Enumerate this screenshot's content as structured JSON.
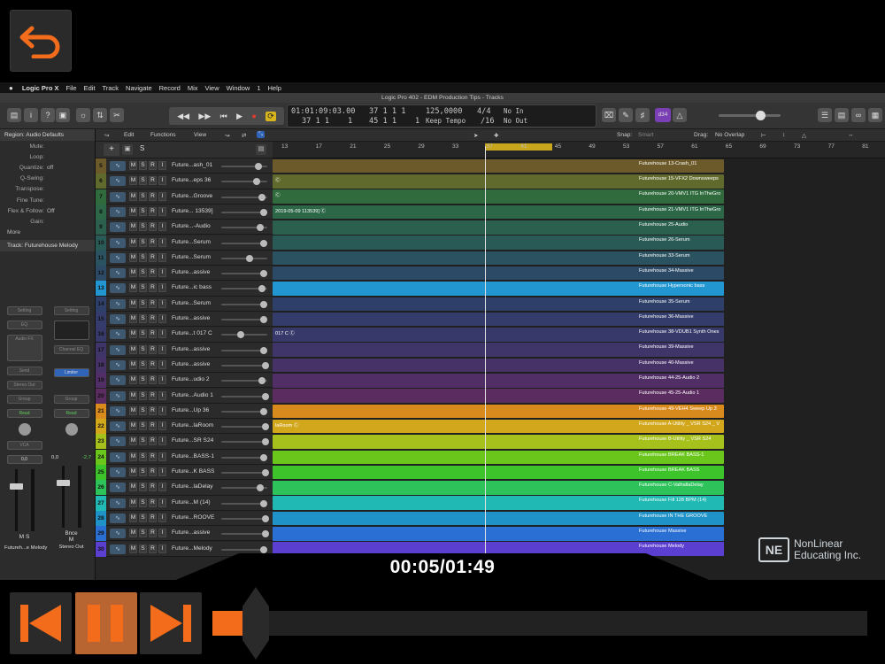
{
  "player": {
    "timecode": "00:05/01:49",
    "progress": 0.046,
    "accent_color": "#f26c1b",
    "back_icon": "back-arrow-icon",
    "watermark": {
      "logo": "NE",
      "line1": "NonLinear",
      "line2": "Educating Inc."
    }
  },
  "mac_menu": {
    "app": "Logic Pro X",
    "items": [
      "File",
      "Edit",
      "Track",
      "Navigate",
      "Record",
      "Mix",
      "View",
      "Window",
      "1",
      "Help"
    ]
  },
  "window_title": "Logic Pro 402 - EDM Production Tips - Tracks",
  "lcd": {
    "time": "01:01:09:03.00",
    "position": "37  1  1      1",
    "bar_beat_top": "37  1  1",
    "end": "45  1  1",
    "num1": "1",
    "num2": "1",
    "tempo": "125,0000",
    "tempo_mode": "Keep Tempo",
    "sig": "4/4",
    "div": "/16",
    "in": "No In",
    "out": "No Out"
  },
  "toolbar": {
    "badge": "d34"
  },
  "inspector": {
    "region_title": "Region: Audio Defaults",
    "rows": [
      {
        "k": "Mute:",
        "v": ""
      },
      {
        "k": "Loop:",
        "v": ""
      },
      {
        "k": "Quantize:",
        "v": "off"
      },
      {
        "k": "Q-Swing:",
        "v": ""
      },
      {
        "k": "Transpose:",
        "v": ""
      },
      {
        "k": "Fine Tune:",
        "v": ""
      },
      {
        "k": "Flex & Follow:",
        "v": "Off"
      },
      {
        "k": "Gain:",
        "v": ""
      }
    ],
    "more": "More",
    "track_title": "Track:  Futurehouse Melody",
    "strip1": {
      "setting": "Setting",
      "eq": "EQ",
      "fx": "Audio FX",
      "send": "Send",
      "out": "Stereo Out",
      "group": "Group",
      "auto": "Read",
      "vca": "VCA",
      "val": "0,0",
      "ms": "M  S",
      "name": "Futureh...e Melody"
    },
    "strip2": {
      "setting": "Setting",
      "eq": "Channel EQ",
      "limiter": "Limiter",
      "group": "Group",
      "auto": "Read",
      "val": "0,0",
      "peak": "-2,7",
      "bnc": "Bnce",
      "ms": "M",
      "name": "Stereo Out"
    }
  },
  "tracks_header": {
    "edit": "Edit",
    "functions": "Functions",
    "view": "View",
    "snap_label": "Snap:",
    "snap": "Smart",
    "drag_label": "Drag:",
    "drag": "No Overlap"
  },
  "list_ctrls": {
    "add": "+",
    "s": "S"
  },
  "ruler": [
    {
      "label": "13"
    },
    {
      "label": "17"
    },
    {
      "label": "21"
    },
    {
      "label": "25"
    },
    {
      "label": "29"
    },
    {
      "label": "33"
    },
    {
      "label": "37"
    },
    {
      "label": "41"
    },
    {
      "label": "45"
    },
    {
      "label": "49"
    },
    {
      "label": "53"
    },
    {
      "label": "57"
    },
    {
      "label": "61"
    },
    {
      "label": "65"
    },
    {
      "label": "69"
    },
    {
      "label": "73"
    },
    {
      "label": "77"
    },
    {
      "label": "81"
    }
  ],
  "tracks": [
    {
      "num": "5",
      "name": "Future...ash_01",
      "color": "#6d5a2a",
      "region": "Futurehouse 13-Crash_01",
      "left": ""
    },
    {
      "num": "6",
      "name": "Future...eps 36",
      "color": "#5f6a2c",
      "region": "Futurehouse 15-VFX2 Downsweeps",
      "left": "Ⓒ"
    },
    {
      "num": "7",
      "name": "Future...Groove",
      "color": "#2f6b3c",
      "region": "Futurehouse 20-VMV1 ITG InTheGro",
      "left": "Ⓒ"
    },
    {
      "num": "8",
      "name": "Future... 13539]",
      "color": "#2c6848",
      "region": "Futurehouse 21-VMV1 ITG InTheGro",
      "left": "2019-05-09 113539]  Ⓒ"
    },
    {
      "num": "9",
      "name": "Future...-Audio",
      "color": "#2b5f4e",
      "region": "Futurehouse 25-Audio",
      "left": ""
    },
    {
      "num": "10",
      "name": "Future...Serum",
      "color": "#2a5a55",
      "region": "Futurehouse 26-Serum",
      "left": ""
    },
    {
      "num": "11",
      "name": "Future...Serum",
      "color": "#2a5260",
      "region": "Futurehouse 33-Serum",
      "left": ""
    },
    {
      "num": "12",
      "name": "Future...assive",
      "color": "#2c4a66",
      "region": "Futurehouse 34-Massive",
      "left": ""
    },
    {
      "num": "13",
      "name": "Future...ic bass",
      "color": "#2196d0",
      "region": "Futurehouse Hypersonic bass",
      "left": ""
    },
    {
      "num": "14",
      "name": "Future...Serum",
      "color": "#2e3f6a",
      "region": "Futurehouse 35-Serum",
      "left": ""
    },
    {
      "num": "15",
      "name": "Future...assive",
      "color": "#333c6a",
      "region": "Futurehouse 36-Massive",
      "left": ""
    },
    {
      "num": "16",
      "name": "Future...t 017 C",
      "color": "#36396a",
      "region": "Futurehouse 38-VDUB1 Synth Ones",
      "left": "017 C  Ⓒ"
    },
    {
      "num": "17",
      "name": "Future...assive",
      "color": "#3f3568",
      "region": "Futurehouse 39-Massive",
      "left": ""
    },
    {
      "num": "18",
      "name": "Future...assive",
      "color": "#463267",
      "region": "Futurehouse 40-Massive",
      "left": ""
    },
    {
      "num": "19",
      "name": "Future...udio 2",
      "color": "#512f66",
      "region": "Futurehouse 44-25-Audio 2",
      "left": ""
    },
    {
      "num": "20",
      "name": "Future...Audio 1",
      "color": "#5a2c5f",
      "region": "Futurehouse 45-25-Audio 1",
      "left": ""
    },
    {
      "num": "21",
      "name": "Future...Up 36",
      "color": "#d98a1c",
      "region": "Futurehouse 49-VEH4 Sweep Up 3",
      "left": ""
    },
    {
      "num": "22",
      "name": "Future...laRoom",
      "color": "#d2a71c",
      "region": "Futurehouse A-Utility _ VSR S24 _ V",
      "left": "laRoom  Ⓒ"
    },
    {
      "num": "23",
      "name": "Future...SR S24",
      "color": "#a6c11c",
      "region": "Futurehouse B-Utility _ VSR S24",
      "left": ""
    },
    {
      "num": "24",
      "name": "Future...BASS-1",
      "color": "#6bc61c",
      "region": "Futurehouse BREAK BASS-1",
      "left": ""
    },
    {
      "num": "25",
      "name": "Future...K BASS",
      "color": "#3cc42a",
      "region": "Futurehouse BREAK BASS",
      "left": ""
    },
    {
      "num": "26",
      "name": "Future...laDelay",
      "color": "#2ec25a",
      "region": "Futurehouse C-ValhallaDelay",
      "left": ""
    },
    {
      "num": "27",
      "name": "Future...M (14)",
      "color": "#20b9b4",
      "region": "Futurehouse Fill 128 BPM (14)",
      "left": ""
    },
    {
      "num": "28",
      "name": "Future...ROOVE",
      "color": "#1f92c8",
      "region": "Futurehouse IN THE GROOVE",
      "left": ""
    },
    {
      "num": "29",
      "name": "Future...assive",
      "color": "#2a6fd4",
      "region": "Futurehouse Massive",
      "left": ""
    },
    {
      "num": "30",
      "name": "Future...Melody",
      "color": "#5a3fd0",
      "region": "Futurehouse Melody",
      "left": ""
    }
  ]
}
